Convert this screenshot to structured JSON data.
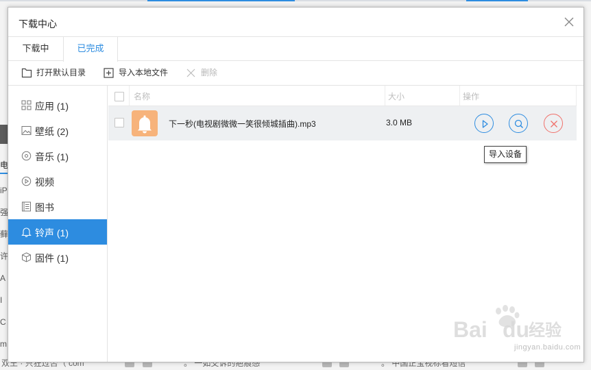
{
  "background": {
    "left_chars": [
      "电",
      "iP",
      "强",
      "藓",
      "许",
      "A",
      "I",
      "C",
      "m"
    ],
    "bottom_texts": [
      "双王 · 只狂过否（ com",
      "。 一如交诉的疤痕感",
      "。 中国正宝视标看短信"
    ]
  },
  "dialog": {
    "title": "下载中心",
    "tabs": [
      {
        "label": "下载中",
        "active": false
      },
      {
        "label": "已完成",
        "active": true
      }
    ],
    "toolbar": {
      "open_dir": "打开默认目录",
      "import_local": "导入本地文件",
      "delete": "删除"
    },
    "sidebar": [
      {
        "label": "应用 (1)",
        "icon": "apps-icon",
        "active": false
      },
      {
        "label": "壁纸 (2)",
        "icon": "image-icon",
        "active": false
      },
      {
        "label": "音乐 (1)",
        "icon": "music-icon",
        "active": false
      },
      {
        "label": "视频",
        "icon": "video-icon",
        "active": false
      },
      {
        "label": "图书",
        "icon": "book-icon",
        "active": false
      },
      {
        "label": "铃声 (1)",
        "icon": "bell-icon",
        "active": true
      },
      {
        "label": "固件 (1)",
        "icon": "box-icon",
        "active": false
      }
    ],
    "table": {
      "columns": [
        "名称",
        "大小",
        "操作"
      ],
      "rows": [
        {
          "name": "下一秒(电视剧微微一笑很倾城插曲).mp3",
          "size": "3.0 MB",
          "icon": "bell-icon"
        }
      ]
    },
    "tooltip": "导入设备"
  },
  "watermark": {
    "brand": "Baidu 经验",
    "url": "jingyan.baidu.com"
  },
  "colors": {
    "accent": "#2d8ce0",
    "danger": "#f0706a",
    "file_icon_bg": "#f7b37b"
  }
}
